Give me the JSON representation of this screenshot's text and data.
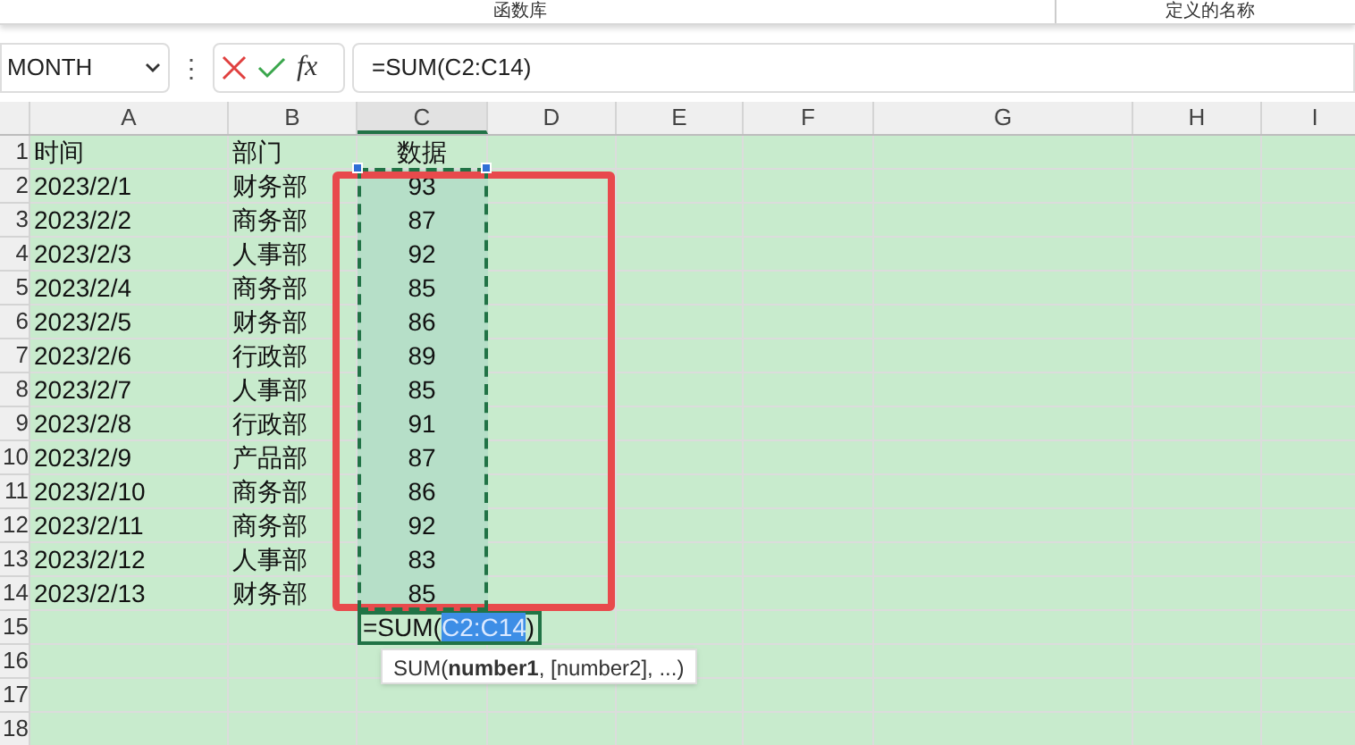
{
  "ribbon": {
    "groups": [
      "函数库",
      "定义的名称"
    ]
  },
  "formula_bar": {
    "name_box": "MONTH",
    "more": "⋮",
    "fx": "fx",
    "formula": "=SUM(C2:C14)"
  },
  "sheet": {
    "columns": [
      {
        "label": "A",
        "selected": false
      },
      {
        "label": "B",
        "selected": false
      },
      {
        "label": "C",
        "selected": true
      },
      {
        "label": "D",
        "selected": false
      },
      {
        "label": "E",
        "selected": false
      },
      {
        "label": "F",
        "selected": false
      },
      {
        "label": "G",
        "selected": false
      },
      {
        "label": "H",
        "selected": false
      },
      {
        "label": "I",
        "selected": false
      }
    ],
    "rows": [
      {
        "number": "1",
        "cells": [
          "时间",
          "部门",
          "数据"
        ],
        "in_range": false
      },
      {
        "number": "2",
        "cells": [
          "2023/2/1",
          "财务部",
          "93"
        ],
        "in_range": true
      },
      {
        "number": "3",
        "cells": [
          "2023/2/2",
          "商务部",
          "87"
        ],
        "in_range": true
      },
      {
        "number": "4",
        "cells": [
          "2023/2/3",
          "人事部",
          "92"
        ],
        "in_range": true
      },
      {
        "number": "5",
        "cells": [
          "2023/2/4",
          "商务部",
          "85"
        ],
        "in_range": true
      },
      {
        "number": "6",
        "cells": [
          "2023/2/5",
          "财务部",
          "86"
        ],
        "in_range": true
      },
      {
        "number": "7",
        "cells": [
          "2023/2/6",
          "行政部",
          "89"
        ],
        "in_range": true
      },
      {
        "number": "8",
        "cells": [
          "2023/2/7",
          "人事部",
          "85"
        ],
        "in_range": true
      },
      {
        "number": "9",
        "cells": [
          "2023/2/8",
          "行政部",
          "91"
        ],
        "in_range": true
      },
      {
        "number": "10",
        "cells": [
          "2023/2/9",
          "产品部",
          "87"
        ],
        "in_range": true
      },
      {
        "number": "11",
        "cells": [
          "2023/2/10",
          "商务部",
          "86"
        ],
        "in_range": true
      },
      {
        "number": "12",
        "cells": [
          "2023/2/11",
          "商务部",
          "92"
        ],
        "in_range": true
      },
      {
        "number": "13",
        "cells": [
          "2023/2/12",
          "人事部",
          "83"
        ],
        "in_range": true
      },
      {
        "number": "14",
        "cells": [
          "2023/2/13",
          "财务部",
          "85"
        ],
        "in_range": true
      },
      {
        "number": "15",
        "cells": [],
        "in_range": false,
        "editing": {
          "prefix": "=SUM(",
          "reference": "C2:C14",
          "suffix": ")"
        }
      },
      {
        "number": "16",
        "cells": [],
        "in_range": false
      },
      {
        "number": "17",
        "cells": [],
        "in_range": false
      },
      {
        "number": "18",
        "cells": [],
        "in_range": false
      }
    ],
    "tooltip": "SUM(**number1**, [number2], ...)"
  }
}
